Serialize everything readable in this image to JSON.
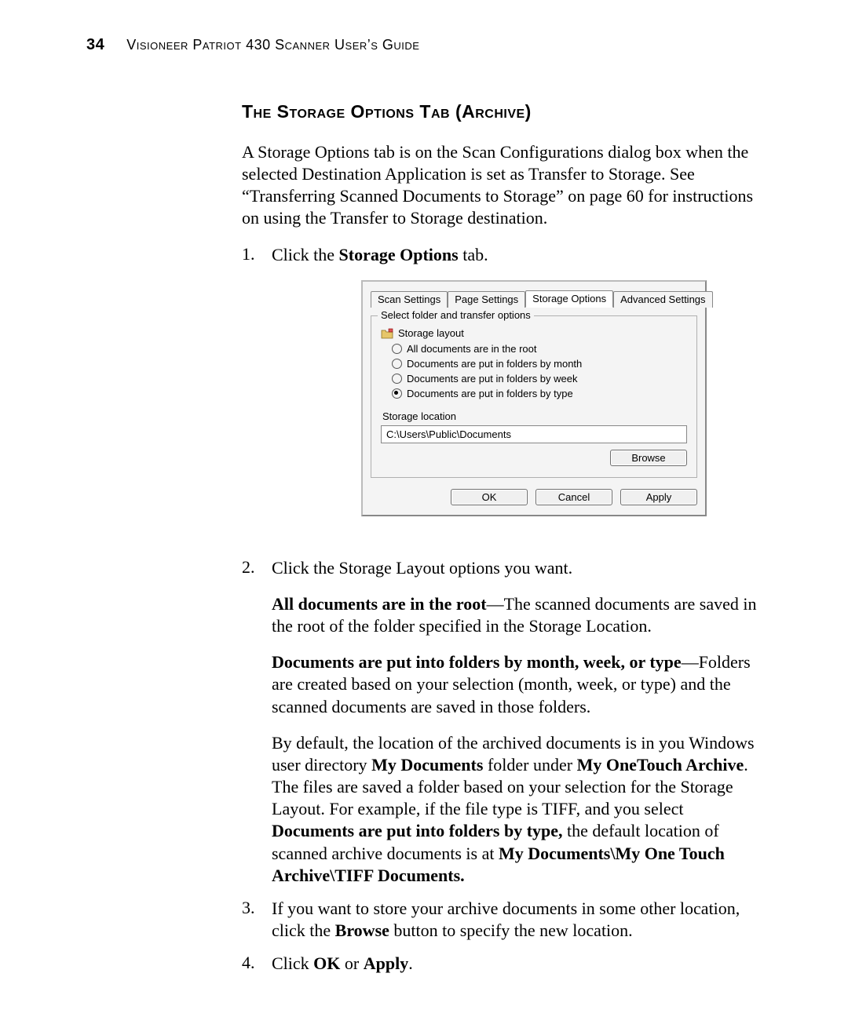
{
  "page_number": "34",
  "running_head": "Visioneer Patriot 430 Scanner User’s Guide",
  "section_heading": "The Storage Options Tab (Archive)",
  "intro_paragraph": "A Storage Options tab is on the Scan Configurations dialog box when the selected Destination Application is set as Transfer to Storage. See “Transferring Scanned Documents to Storage” on page 60 for instructions on using the Transfer to Storage destination.",
  "steps": {
    "s1_prefix": "Click the ",
    "s1_bold": "Storage Options",
    "s1_suffix": " tab.",
    "s2": "Click the Storage Layout options you want.",
    "s2_p1_b": "All documents are in the root",
    "s2_p1_rest": "—The scanned documents are saved in the root of the folder specified in the Storage Location.",
    "s2_p2_b": "Documents are put into folders by month, week, or type",
    "s2_p2_rest": "—Folders are created based on your selection (month, week, or type) and the scanned documents are saved in those folders.",
    "s2_p3_a": "By default, the location of the archived documents is in you Windows user directory ",
    "s2_p3_b1": "My Documents",
    "s2_p3_c": " folder under ",
    "s2_p3_b2": "My OneTouch Archive",
    "s2_p3_d": ". The files are saved a folder based on your selection for the Storage Layout. For example, if the file type is TIFF, and you select ",
    "s2_p3_b3": "Documents are put into folders by type,",
    "s2_p3_e": " the default location of scanned archive documents is at ",
    "s2_p3_b4": "My Documents\\My One Touch Archive\\TIFF Documents.",
    "s3_a": "If you want to store your archive documents in some other location, click the ",
    "s3_b": "Browse",
    "s3_c": " button to specify the new location.",
    "s4_a": "Click ",
    "s4_b1": "OK",
    "s4_mid": " or ",
    "s4_b2": "Apply",
    "s4_end": "."
  },
  "dialog": {
    "tabs": {
      "scan": "Scan Settings",
      "page": "Page Settings",
      "storage": "Storage Options",
      "adv": "Advanced Settings"
    },
    "group_legend": "Select folder and transfer options",
    "layout_label": "Storage layout",
    "radio1": "All documents are in the root",
    "radio2": "Documents are put in folders by month",
    "radio3": "Documents are put in folders by week",
    "radio4": "Documents are put in folders by type",
    "loc_label": "Storage location",
    "loc_value": "C:\\Users\\Public\\Documents",
    "browse": "Browse",
    "ok": "OK",
    "cancel": "Cancel",
    "apply": "Apply"
  }
}
